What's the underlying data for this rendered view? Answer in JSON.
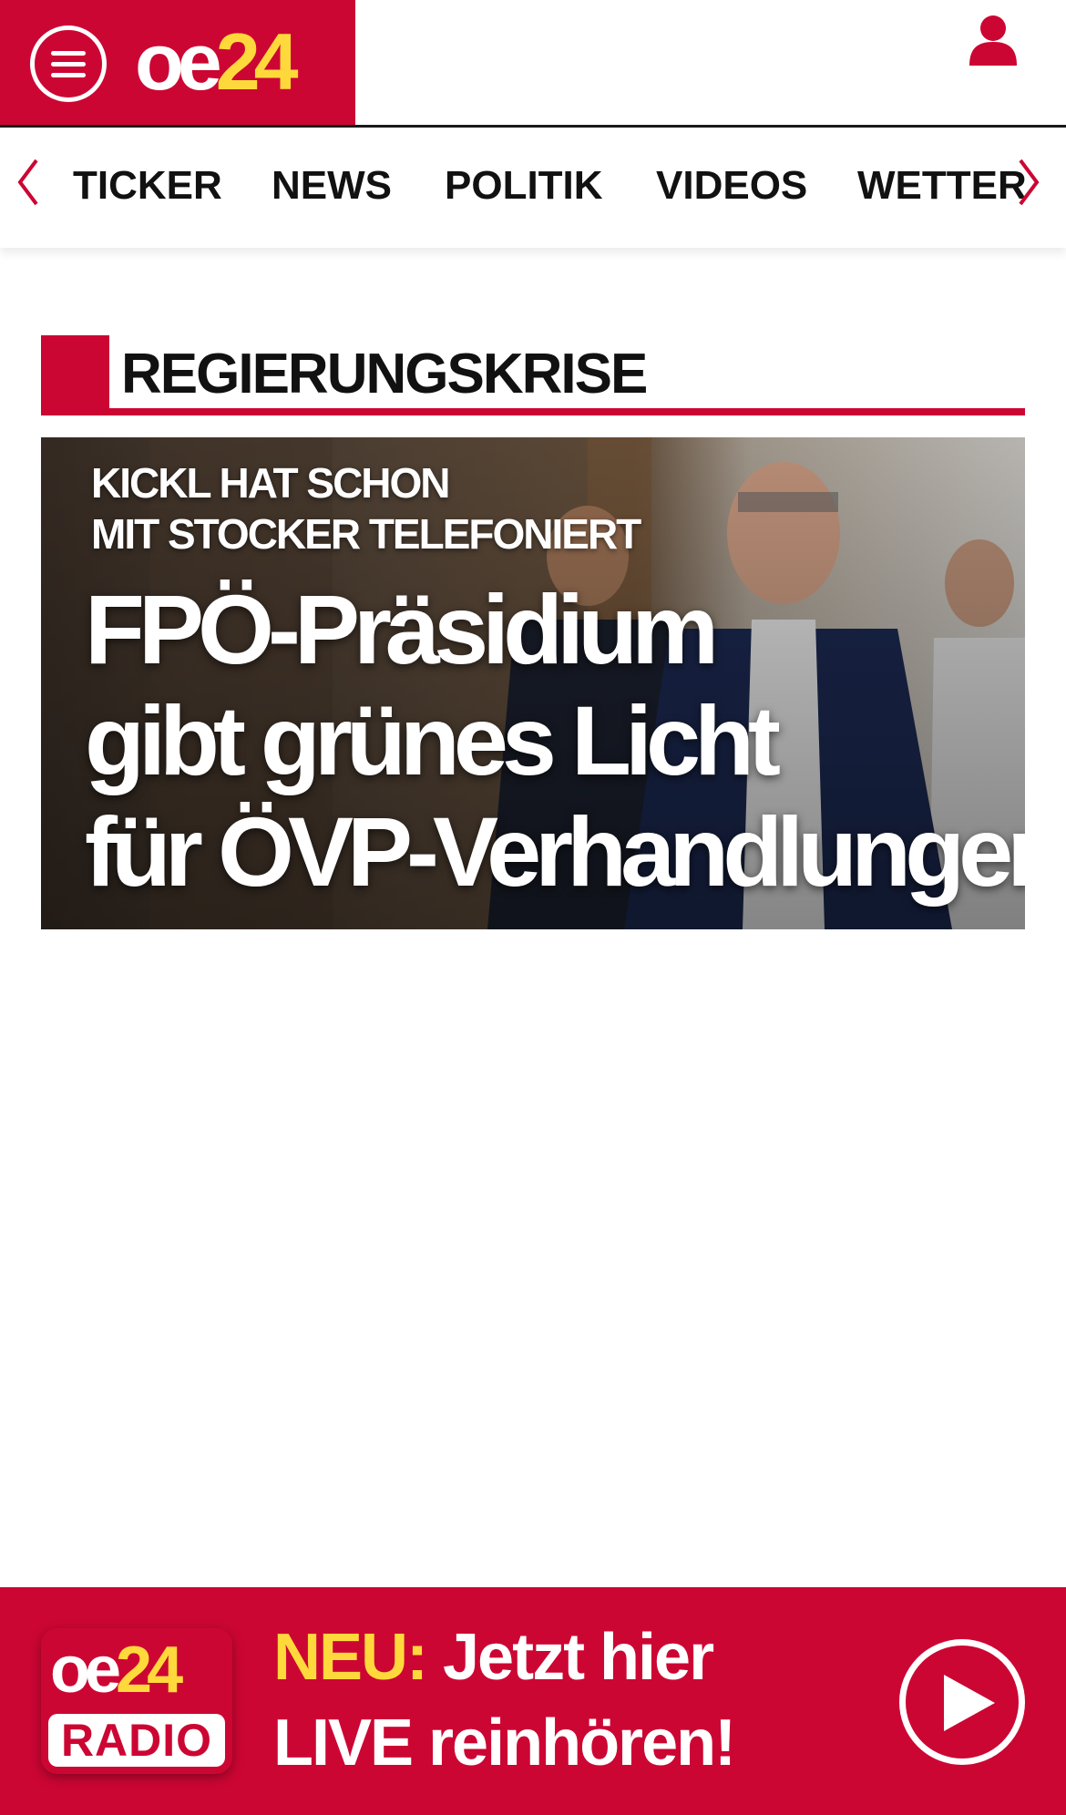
{
  "header": {
    "logo_oe": "oe",
    "logo_24": "24",
    "menu_icon": "hamburger-menu-icon",
    "user_icon": "user-icon",
    "colors": {
      "brand_red": "#cc0633",
      "logo_yellow": "#ffd93b"
    }
  },
  "nav": {
    "prev_icon": "chevron-left-icon",
    "next_icon": "chevron-right-icon",
    "items": [
      "TICKER",
      "NEWS",
      "POLITIK",
      "VIDEOS",
      "WETTER"
    ]
  },
  "section": {
    "title": "REGIERUNGSKRISE"
  },
  "hero": {
    "kicker_line1": "KICKL HAT SCHON",
    "kicker_line2": "MIT STOCKER TELEFONIERT",
    "headline_line1": "FPÖ-Präsidium",
    "headline_line2": "gibt grünes Licht",
    "headline_line3": "für ÖVP-Verhandlungen"
  },
  "radio": {
    "logo_oe": "oe",
    "logo_24": "24",
    "logo_radio": "RADIO",
    "neu": "NEU:",
    "line1_rest": " Jetzt hier",
    "line2": "LIVE reinhören!",
    "play_icon": "play-icon"
  }
}
